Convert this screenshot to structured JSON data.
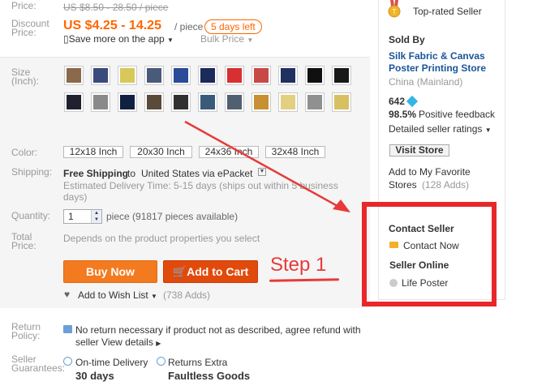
{
  "price": {
    "label": "Price:",
    "original": "US $8.50 - 28.50 / piece",
    "discount_label": "Discount Price:",
    "discount": "US $4.25 - 14.25",
    "per": "/ piece",
    "days_left": "5 days left",
    "save_app": "Save more on the app",
    "bulk": "Bulk Price"
  },
  "size": {
    "label": "Size (Inch):",
    "thumb_colors": [
      "#8a6a4a",
      "#3a4a7a",
      "#d8c85a",
      "#4a5a7a",
      "#2a4a9a",
      "#1a2a5a",
      "#d83030",
      "#c84848",
      "#203060",
      "#101010",
      "#181818",
      "#202030",
      "#8a8a8a",
      "#102040",
      "#5a4a3a",
      "#303030",
      "#3a5a7a",
      "#506070",
      "#c89030",
      "#e0d080",
      "#909090",
      "#d8c060"
    ]
  },
  "colors": {
    "label": "Color:",
    "options": [
      "12x18 Inch",
      "20x30 Inch",
      "24x36 Inch",
      "32x48 Inch"
    ]
  },
  "shipping": {
    "label": "Shipping:",
    "free": "Free Shipping",
    "to": "to",
    "country": "United States via ePacket",
    "estimate": "Estimated Delivery Time: 5-15 days (ships out within 5 business days)"
  },
  "quantity": {
    "label": "Quantity:",
    "value": "1",
    "available": "piece (91817 pieces available)"
  },
  "total": {
    "label": "Total Price:",
    "text": "Depends on the product properties you select"
  },
  "actions": {
    "buy_now": "Buy Now",
    "add_to_cart": "Add to Cart",
    "wish_list": "Add to Wish List",
    "wish_count": "(738 Adds)"
  },
  "annotation": {
    "step": "Step 1",
    "color": "#e83a3a"
  },
  "return_policy": {
    "label": "Return Policy:",
    "text": "No return necessary if product not as described, agree refund with seller",
    "details": "View details"
  },
  "guarantees": {
    "label": "Seller Guarantees:",
    "ontime_title": "On-time Delivery",
    "ontime_value": "30 days",
    "returns_title": "Returns Extra",
    "returns_value": "Faultless Goods"
  },
  "seller": {
    "badge": "Top-rated Seller",
    "sold_by": "Sold By",
    "store_name": "Silk Fabric & Canvas Poster Printing Store",
    "country": "China (Mainland)",
    "score": "642",
    "feedback_pct": "98.5%",
    "feedback_label": "Positive feedback",
    "detailed_ratings": "Detailed seller ratings",
    "visit_store": "Visit Store",
    "fav_line1": "Add to My Favorite",
    "fav_line2": "Stores",
    "fav_adds": "(128 Adds)",
    "contact_title": "Contact Seller",
    "contact_now": "Contact Now",
    "online_title": "Seller Online",
    "online_name": "Life Poster"
  }
}
